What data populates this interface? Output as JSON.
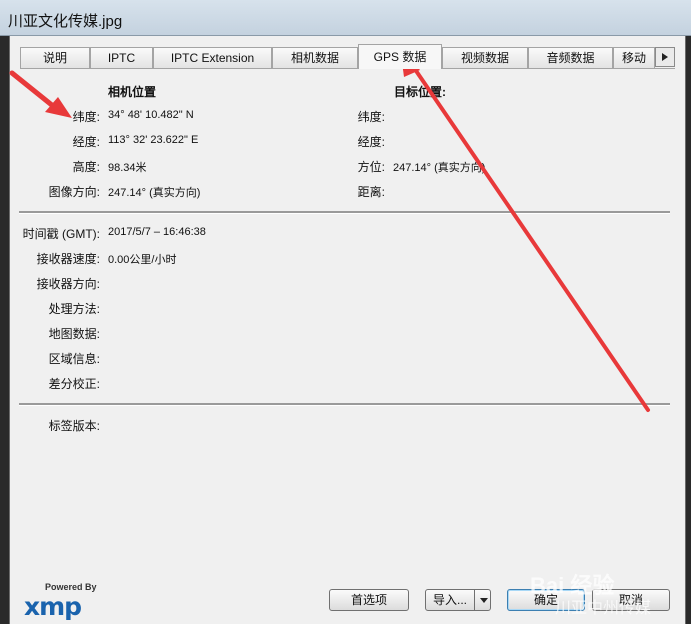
{
  "window": {
    "title": "川亚文化传媒.jpg"
  },
  "tabs": [
    "说明",
    "IPTC",
    "IPTC Extension",
    "相机数据",
    "GPS 数据",
    "视频数据",
    "音频数据",
    "移动"
  ],
  "active_tab": "GPS 数据",
  "camera_location": {
    "heading": "相机位置",
    "latitude_label": "纬度:",
    "latitude": "34° 48' 10.482\" N",
    "longitude_label": "经度:",
    "longitude": "113° 32' 23.622\" E",
    "altitude_label": "高度:",
    "altitude": "98.34米",
    "image_direction_label": "图像方向:",
    "image_direction": "247.14° (真实方向)"
  },
  "target_location": {
    "heading": "目标位置:",
    "latitude_label": "纬度:",
    "latitude": "",
    "longitude_label": "经度:",
    "longitude": "",
    "bearing_label": "方位:",
    "bearing": "247.14° (真实方向)",
    "distance_label": "距离:",
    "distance": ""
  },
  "details": {
    "timestamp_label": "时间戳 (GMT):",
    "timestamp": "2017/5/7 – 16:46:38",
    "receiver_speed_label": "接收器速度:",
    "receiver_speed": "0.00公里/小时",
    "receiver_direction_label": "接收器方向:",
    "receiver_direction": "",
    "processing_label": "处理方法:",
    "processing": "",
    "map_datum_label": "地图数据:",
    "map_datum": "",
    "area_info_label": "区域信息:",
    "area_info": "",
    "differential_label": "差分校正:",
    "differential": "",
    "tag_version_label": "标签版本:",
    "tag_version": ""
  },
  "footer": {
    "powered_by": "Powered By",
    "xmp": "xmp",
    "preferences": "首选项",
    "import": "导入...",
    "ok": "确定",
    "cancel": "取消"
  },
  "watermark": {
    "line1": "Bai 经验",
    "line2": "川亚中州传媒"
  },
  "annotation_color": "#e8393a"
}
